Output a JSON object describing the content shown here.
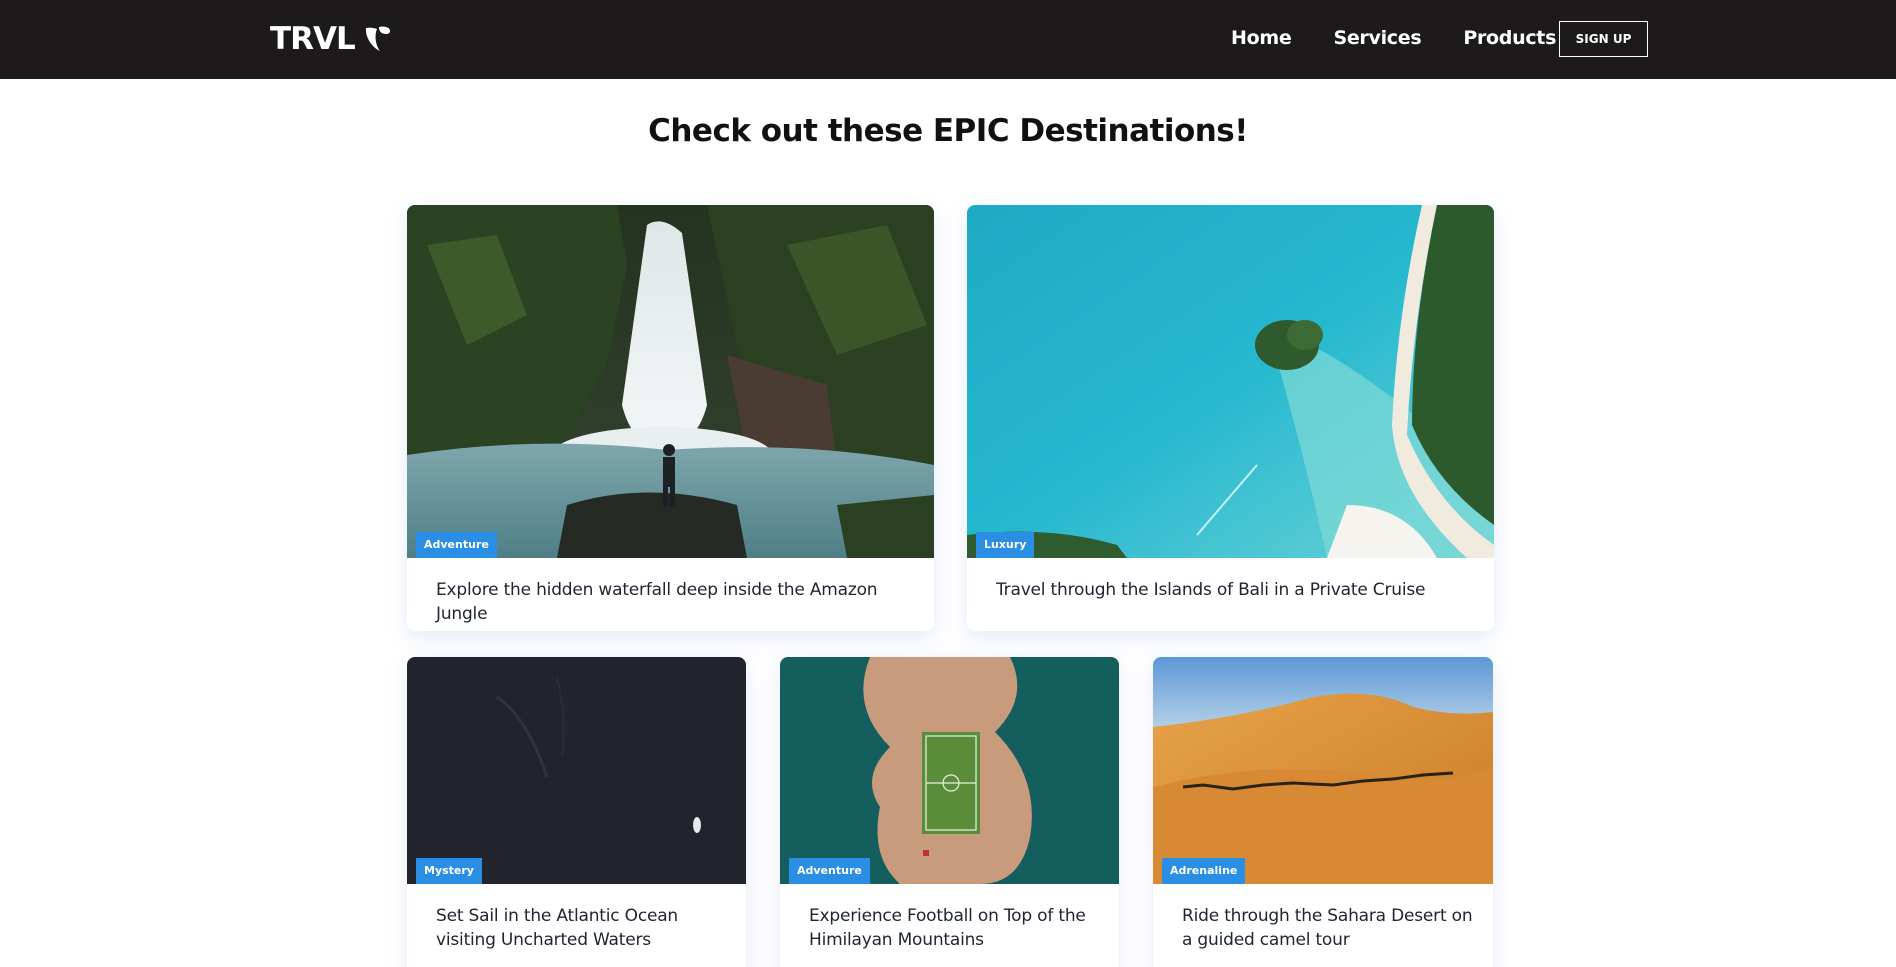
{
  "navbar": {
    "logo_text": "TRVL",
    "logo_icon": "typo3-icon",
    "links": [
      {
        "label": "Home"
      },
      {
        "label": "Services"
      },
      {
        "label": "Products"
      }
    ],
    "signup_label": "SIGN UP"
  },
  "page": {
    "title": "Check out these EPIC Destinations!"
  },
  "cards": [
    {
      "badge": "Adventure",
      "title": "Explore the hidden waterfall deep inside the Amazon Jungle"
    },
    {
      "badge": "Luxury",
      "title": "Travel through the Islands of Bali in a Private Cruise"
    },
    {
      "badge": "Mystery",
      "title": "Set Sail in the Atlantic Ocean visiting Uncharted Waters"
    },
    {
      "badge": "Adventure",
      "title": "Experience Football on Top of the Himilayan Mountains"
    },
    {
      "badge": "Adrenaline",
      "title": "Ride through the Sahara Desert on a guided camel tour"
    }
  ],
  "colors": {
    "navbar_bg": "#1c1a1a",
    "badge_bg": "#2a8fe4"
  }
}
